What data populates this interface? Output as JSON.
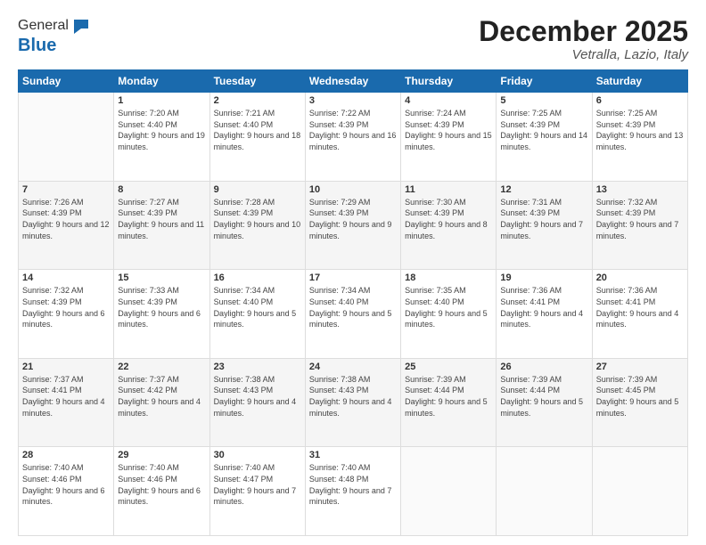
{
  "logo": {
    "general": "General",
    "blue": "Blue"
  },
  "header": {
    "month": "December 2025",
    "location": "Vetralla, Lazio, Italy"
  },
  "weekdays": [
    "Sunday",
    "Monday",
    "Tuesday",
    "Wednesday",
    "Thursday",
    "Friday",
    "Saturday"
  ],
  "weeks": [
    [
      {
        "day": "",
        "sunrise": "",
        "sunset": "",
        "daylight": ""
      },
      {
        "day": "1",
        "sunrise": "Sunrise: 7:20 AM",
        "sunset": "Sunset: 4:40 PM",
        "daylight": "Daylight: 9 hours and 19 minutes."
      },
      {
        "day": "2",
        "sunrise": "Sunrise: 7:21 AM",
        "sunset": "Sunset: 4:40 PM",
        "daylight": "Daylight: 9 hours and 18 minutes."
      },
      {
        "day": "3",
        "sunrise": "Sunrise: 7:22 AM",
        "sunset": "Sunset: 4:39 PM",
        "daylight": "Daylight: 9 hours and 16 minutes."
      },
      {
        "day": "4",
        "sunrise": "Sunrise: 7:24 AM",
        "sunset": "Sunset: 4:39 PM",
        "daylight": "Daylight: 9 hours and 15 minutes."
      },
      {
        "day": "5",
        "sunrise": "Sunrise: 7:25 AM",
        "sunset": "Sunset: 4:39 PM",
        "daylight": "Daylight: 9 hours and 14 minutes."
      },
      {
        "day": "6",
        "sunrise": "Sunrise: 7:25 AM",
        "sunset": "Sunset: 4:39 PM",
        "daylight": "Daylight: 9 hours and 13 minutes."
      }
    ],
    [
      {
        "day": "7",
        "sunrise": "Sunrise: 7:26 AM",
        "sunset": "Sunset: 4:39 PM",
        "daylight": "Daylight: 9 hours and 12 minutes."
      },
      {
        "day": "8",
        "sunrise": "Sunrise: 7:27 AM",
        "sunset": "Sunset: 4:39 PM",
        "daylight": "Daylight: 9 hours and 11 minutes."
      },
      {
        "day": "9",
        "sunrise": "Sunrise: 7:28 AM",
        "sunset": "Sunset: 4:39 PM",
        "daylight": "Daylight: 9 hours and 10 minutes."
      },
      {
        "day": "10",
        "sunrise": "Sunrise: 7:29 AM",
        "sunset": "Sunset: 4:39 PM",
        "daylight": "Daylight: 9 hours and 9 minutes."
      },
      {
        "day": "11",
        "sunrise": "Sunrise: 7:30 AM",
        "sunset": "Sunset: 4:39 PM",
        "daylight": "Daylight: 9 hours and 8 minutes."
      },
      {
        "day": "12",
        "sunrise": "Sunrise: 7:31 AM",
        "sunset": "Sunset: 4:39 PM",
        "daylight": "Daylight: 9 hours and 7 minutes."
      },
      {
        "day": "13",
        "sunrise": "Sunrise: 7:32 AM",
        "sunset": "Sunset: 4:39 PM",
        "daylight": "Daylight: 9 hours and 7 minutes."
      }
    ],
    [
      {
        "day": "14",
        "sunrise": "Sunrise: 7:32 AM",
        "sunset": "Sunset: 4:39 PM",
        "daylight": "Daylight: 9 hours and 6 minutes."
      },
      {
        "day": "15",
        "sunrise": "Sunrise: 7:33 AM",
        "sunset": "Sunset: 4:39 PM",
        "daylight": "Daylight: 9 hours and 6 minutes."
      },
      {
        "day": "16",
        "sunrise": "Sunrise: 7:34 AM",
        "sunset": "Sunset: 4:40 PM",
        "daylight": "Daylight: 9 hours and 5 minutes."
      },
      {
        "day": "17",
        "sunrise": "Sunrise: 7:34 AM",
        "sunset": "Sunset: 4:40 PM",
        "daylight": "Daylight: 9 hours and 5 minutes."
      },
      {
        "day": "18",
        "sunrise": "Sunrise: 7:35 AM",
        "sunset": "Sunset: 4:40 PM",
        "daylight": "Daylight: 9 hours and 5 minutes."
      },
      {
        "day": "19",
        "sunrise": "Sunrise: 7:36 AM",
        "sunset": "Sunset: 4:41 PM",
        "daylight": "Daylight: 9 hours and 4 minutes."
      },
      {
        "day": "20",
        "sunrise": "Sunrise: 7:36 AM",
        "sunset": "Sunset: 4:41 PM",
        "daylight": "Daylight: 9 hours and 4 minutes."
      }
    ],
    [
      {
        "day": "21",
        "sunrise": "Sunrise: 7:37 AM",
        "sunset": "Sunset: 4:41 PM",
        "daylight": "Daylight: 9 hours and 4 minutes."
      },
      {
        "day": "22",
        "sunrise": "Sunrise: 7:37 AM",
        "sunset": "Sunset: 4:42 PM",
        "daylight": "Daylight: 9 hours and 4 minutes."
      },
      {
        "day": "23",
        "sunrise": "Sunrise: 7:38 AM",
        "sunset": "Sunset: 4:43 PM",
        "daylight": "Daylight: 9 hours and 4 minutes."
      },
      {
        "day": "24",
        "sunrise": "Sunrise: 7:38 AM",
        "sunset": "Sunset: 4:43 PM",
        "daylight": "Daylight: 9 hours and 4 minutes."
      },
      {
        "day": "25",
        "sunrise": "Sunrise: 7:39 AM",
        "sunset": "Sunset: 4:44 PM",
        "daylight": "Daylight: 9 hours and 5 minutes."
      },
      {
        "day": "26",
        "sunrise": "Sunrise: 7:39 AM",
        "sunset": "Sunset: 4:44 PM",
        "daylight": "Daylight: 9 hours and 5 minutes."
      },
      {
        "day": "27",
        "sunrise": "Sunrise: 7:39 AM",
        "sunset": "Sunset: 4:45 PM",
        "daylight": "Daylight: 9 hours and 5 minutes."
      }
    ],
    [
      {
        "day": "28",
        "sunrise": "Sunrise: 7:40 AM",
        "sunset": "Sunset: 4:46 PM",
        "daylight": "Daylight: 9 hours and 6 minutes."
      },
      {
        "day": "29",
        "sunrise": "Sunrise: 7:40 AM",
        "sunset": "Sunset: 4:46 PM",
        "daylight": "Daylight: 9 hours and 6 minutes."
      },
      {
        "day": "30",
        "sunrise": "Sunrise: 7:40 AM",
        "sunset": "Sunset: 4:47 PM",
        "daylight": "Daylight: 9 hours and 7 minutes."
      },
      {
        "day": "31",
        "sunrise": "Sunrise: 7:40 AM",
        "sunset": "Sunset: 4:48 PM",
        "daylight": "Daylight: 9 hours and 7 minutes."
      },
      {
        "day": "",
        "sunrise": "",
        "sunset": "",
        "daylight": ""
      },
      {
        "day": "",
        "sunrise": "",
        "sunset": "",
        "daylight": ""
      },
      {
        "day": "",
        "sunrise": "",
        "sunset": "",
        "daylight": ""
      }
    ]
  ]
}
